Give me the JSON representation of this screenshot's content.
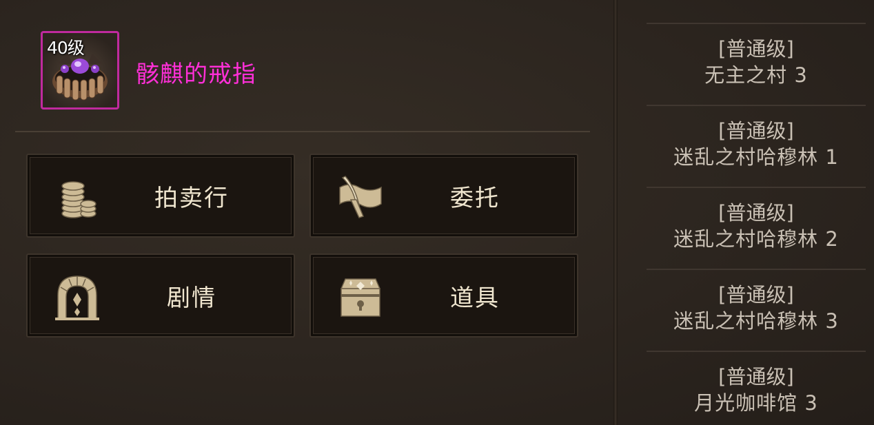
{
  "item": {
    "level": "40级",
    "name": "骸麒的戒指",
    "icon": "ring-icon",
    "border_color": "#c02a9e",
    "name_color": "#ff2fd8"
  },
  "menu": {
    "buttons": [
      {
        "label": "拍卖行",
        "icon": "coin-stack-icon"
      },
      {
        "label": "委托",
        "icon": "scroll-quill-icon"
      },
      {
        "label": "剧情",
        "icon": "stone-arch-icon"
      },
      {
        "label": "道具",
        "icon": "treasure-chest-icon"
      }
    ]
  },
  "dungeons": [
    {
      "grade": "[普通级]",
      "name": "无主之村 3"
    },
    {
      "grade": "[普通级]",
      "name": "迷乱之村哈穆林 1"
    },
    {
      "grade": "[普通级]",
      "name": "迷乱之村哈穆林 2"
    },
    {
      "grade": "[普通级]",
      "name": "迷乱之村哈穆林 3"
    },
    {
      "grade": "[普通级]",
      "name": "月光咖啡馆 3"
    }
  ]
}
